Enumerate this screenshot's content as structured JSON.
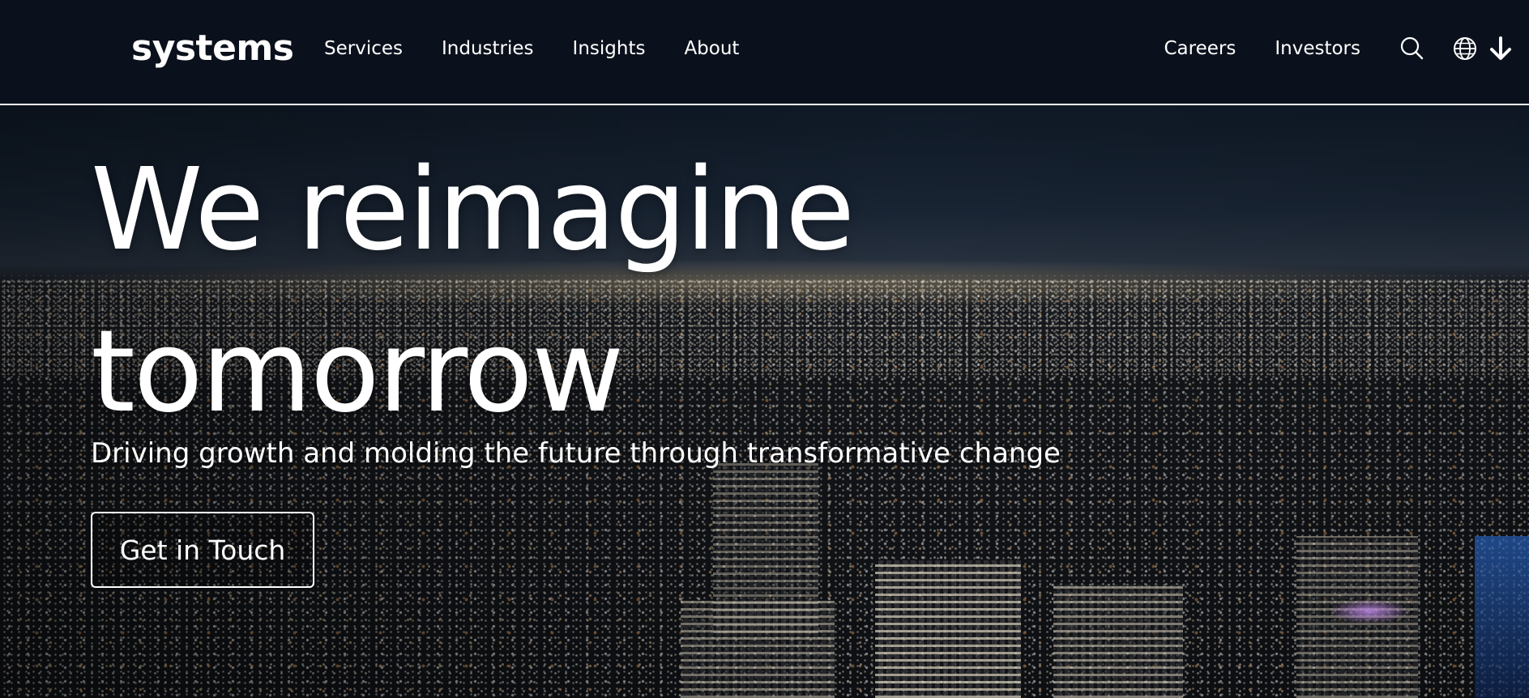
{
  "header": {
    "logo": "systems",
    "nav_left": [
      {
        "label": "Services"
      },
      {
        "label": "Industries"
      },
      {
        "label": "Insights"
      },
      {
        "label": "About"
      }
    ],
    "nav_right": [
      {
        "label": "Careers"
      },
      {
        "label": "Investors"
      }
    ],
    "icons": [
      "search-icon",
      "globe-icon",
      "arrow-down-icon"
    ]
  },
  "hero": {
    "title_line1": "We reimagine",
    "title_line2": "tomorrow",
    "subtitle": "Driving growth and molding the future through transformative change",
    "cta_label": "Get in Touch"
  },
  "colors": {
    "header_bg": "#0b111c",
    "text": "#ffffff",
    "divider": "#ffffff"
  }
}
